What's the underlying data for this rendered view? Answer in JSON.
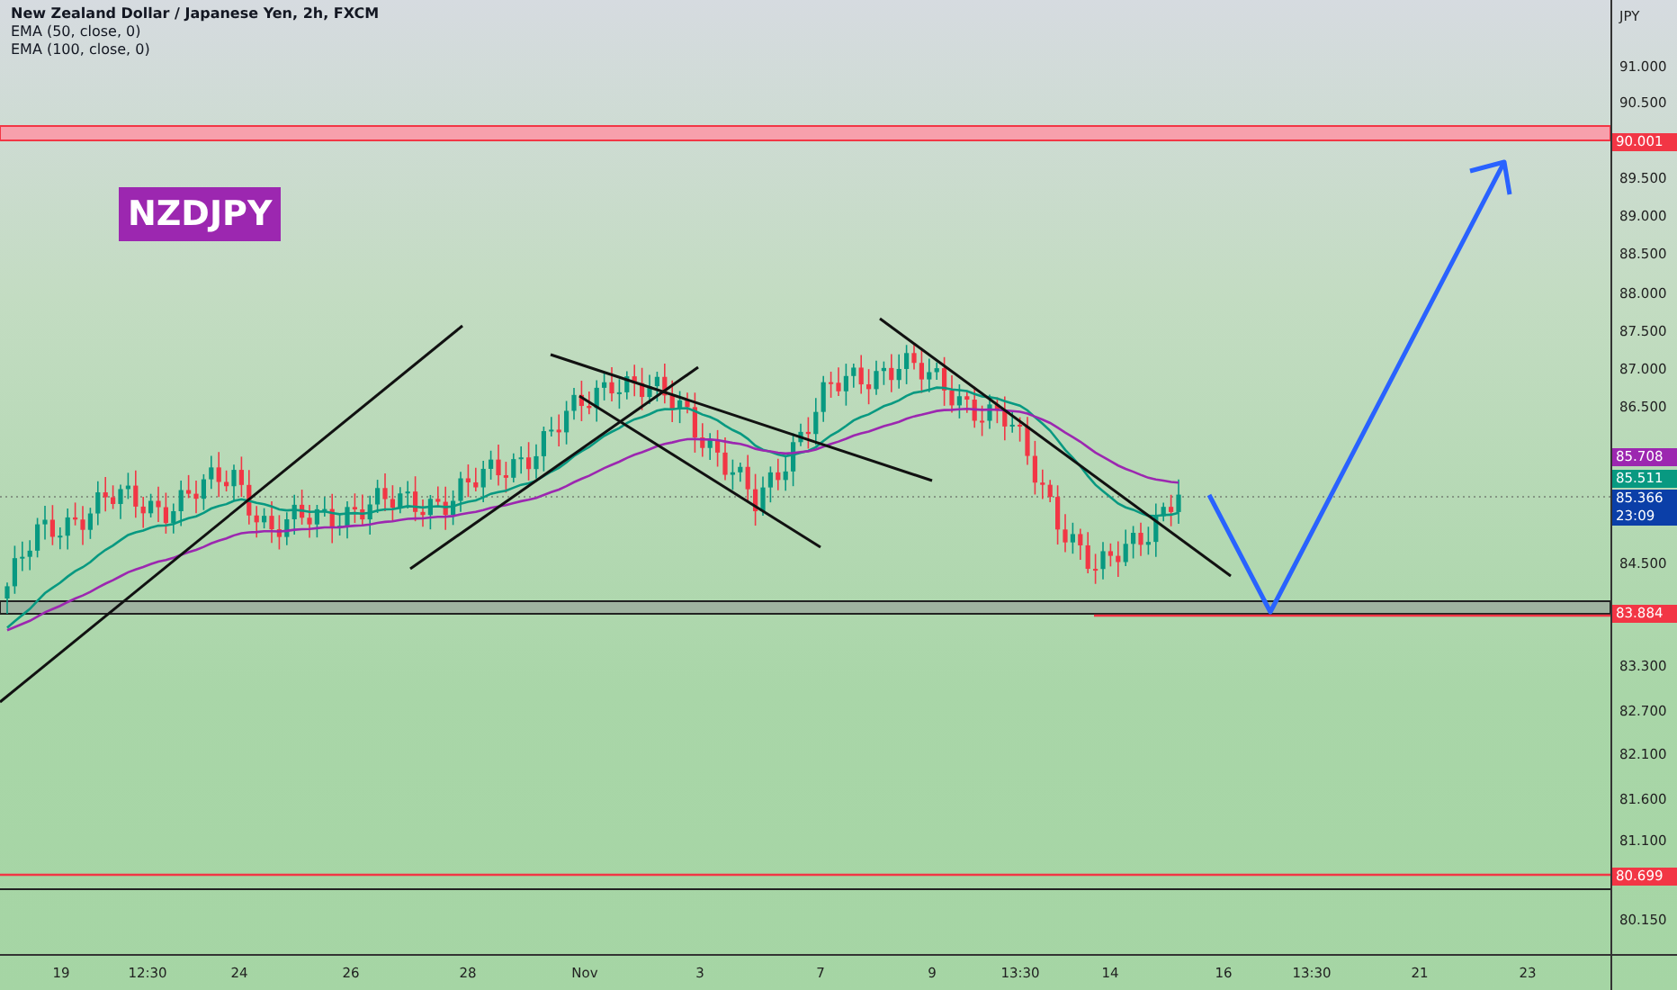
{
  "legend": {
    "title": "New Zealand Dollar / Japanese Yen, 2h, FXCM",
    "indicators": [
      "EMA (50, close, 0)",
      "EMA (100, close, 0)"
    ]
  },
  "symbol_badge": "NZDJPY",
  "price_axis": {
    "unit": "JPY",
    "ticks": [
      "91.000",
      "90.500",
      "89.500",
      "89.000",
      "88.500",
      "88.000",
      "87.500",
      "87.000",
      "86.500",
      "84.500",
      "83.300",
      "82.700",
      "82.100",
      "81.600",
      "81.100",
      "80.150"
    ]
  },
  "price_tags": [
    {
      "text": "90.001",
      "color": "#f23645"
    },
    {
      "text": "85.708",
      "color": "#9c27b0"
    },
    {
      "text": "85.511",
      "color": "#089981"
    },
    {
      "text": "85.366",
      "countdown": "23:09",
      "color": "#0b3fa8"
    },
    {
      "text": "83.884",
      "color": "#f23645"
    },
    {
      "text": "80.699",
      "color": "#f23645"
    }
  ],
  "time_axis": [
    "19",
    "12:30",
    "24",
    "26",
    "28",
    "Nov",
    "3",
    "7",
    "9",
    "13:30",
    "14",
    "16",
    "13:30",
    "21",
    "23"
  ]
}
